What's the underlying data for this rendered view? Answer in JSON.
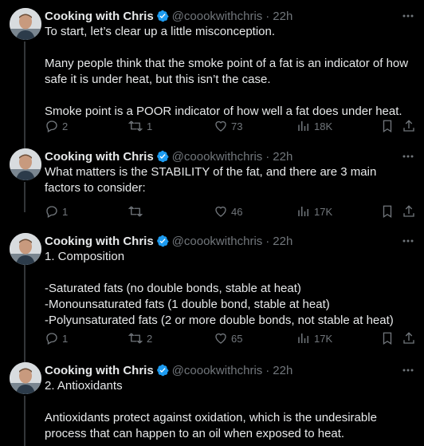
{
  "tweets": [
    {
      "author": "Cooking with Chris",
      "handle": "@coookwithchris",
      "sep": "·",
      "time": "22h",
      "text": "To start, let’s clear up a little misconception.\n\nMany people think that the smoke point of a fat is an indicator of how safe it is under heat, but this isn’t the case.\n\nSmoke point is a POOR indicator of how well a fat does under heat.",
      "replies": "2",
      "reposts": "1",
      "likes": "73",
      "views": "18K"
    },
    {
      "author": "Cooking with Chris",
      "handle": "@coookwithchris",
      "sep": "·",
      "time": "22h",
      "text": "What matters is the STABILITY of the fat, and there are 3 main factors to consider:",
      "replies": "1",
      "reposts": "",
      "likes": "46",
      "views": "17K"
    },
    {
      "author": "Cooking with Chris",
      "handle": "@coookwithchris",
      "sep": "·",
      "time": "22h",
      "text": "1. Composition\n\n-Saturated fats (no double bonds, stable at heat)\n-Monounsaturated fats (1 double bond, stable at heat)\n-Polyunsaturated fats (2 or more double bonds, not stable at heat)",
      "replies": "1",
      "reposts": "2",
      "likes": "65",
      "views": "17K"
    },
    {
      "author": "Cooking with Chris",
      "handle": "@coookwithchris",
      "sep": "·",
      "time": "22h",
      "text": "2. Antioxidants\n\nAntioxidants protect against oxidation, which is the undesirable process that can happen to an oil when exposed to heat."
    }
  ],
  "icons": {
    "reply": "reply-icon",
    "repost": "repost-icon",
    "like": "heart-icon",
    "views": "views-icon",
    "bookmark": "bookmark-icon",
    "share": "share-icon",
    "verified": "verified-badge-icon",
    "more": "more-options-icon"
  },
  "colors": {
    "background": "#000000",
    "text": "#e7e9ea",
    "muted": "#71767b",
    "verified": "#1d9bf0",
    "thread_line": "#333639"
  }
}
